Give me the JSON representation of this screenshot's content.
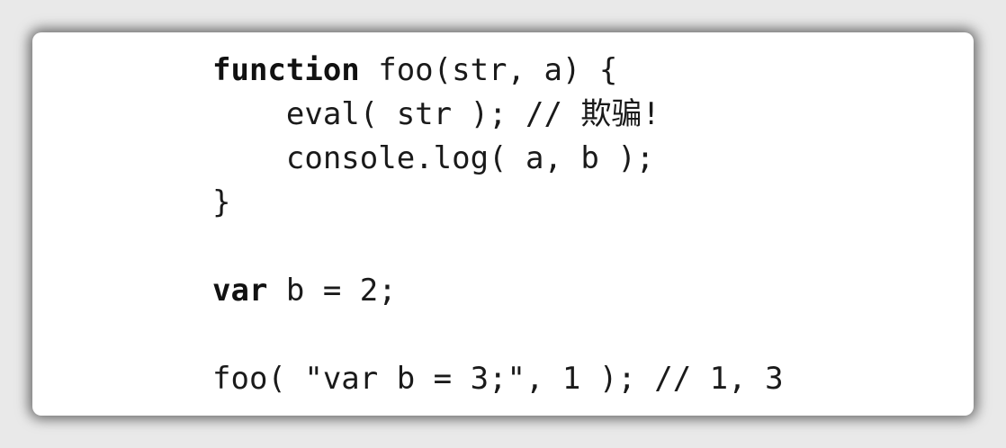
{
  "code": {
    "lines": [
      {
        "keyword": "function",
        "text": " foo(str, a) {"
      },
      {
        "text": "    eval( str ); // 欺骗!"
      },
      {
        "text": "    console.log( a, b );"
      },
      {
        "text": "}"
      },
      {
        "text": ""
      },
      {
        "keyword": "var",
        "text": " b = 2;"
      },
      {
        "text": ""
      },
      {
        "text": "foo( \"var b = 3;\", 1 ); // 1, 3"
      }
    ]
  }
}
